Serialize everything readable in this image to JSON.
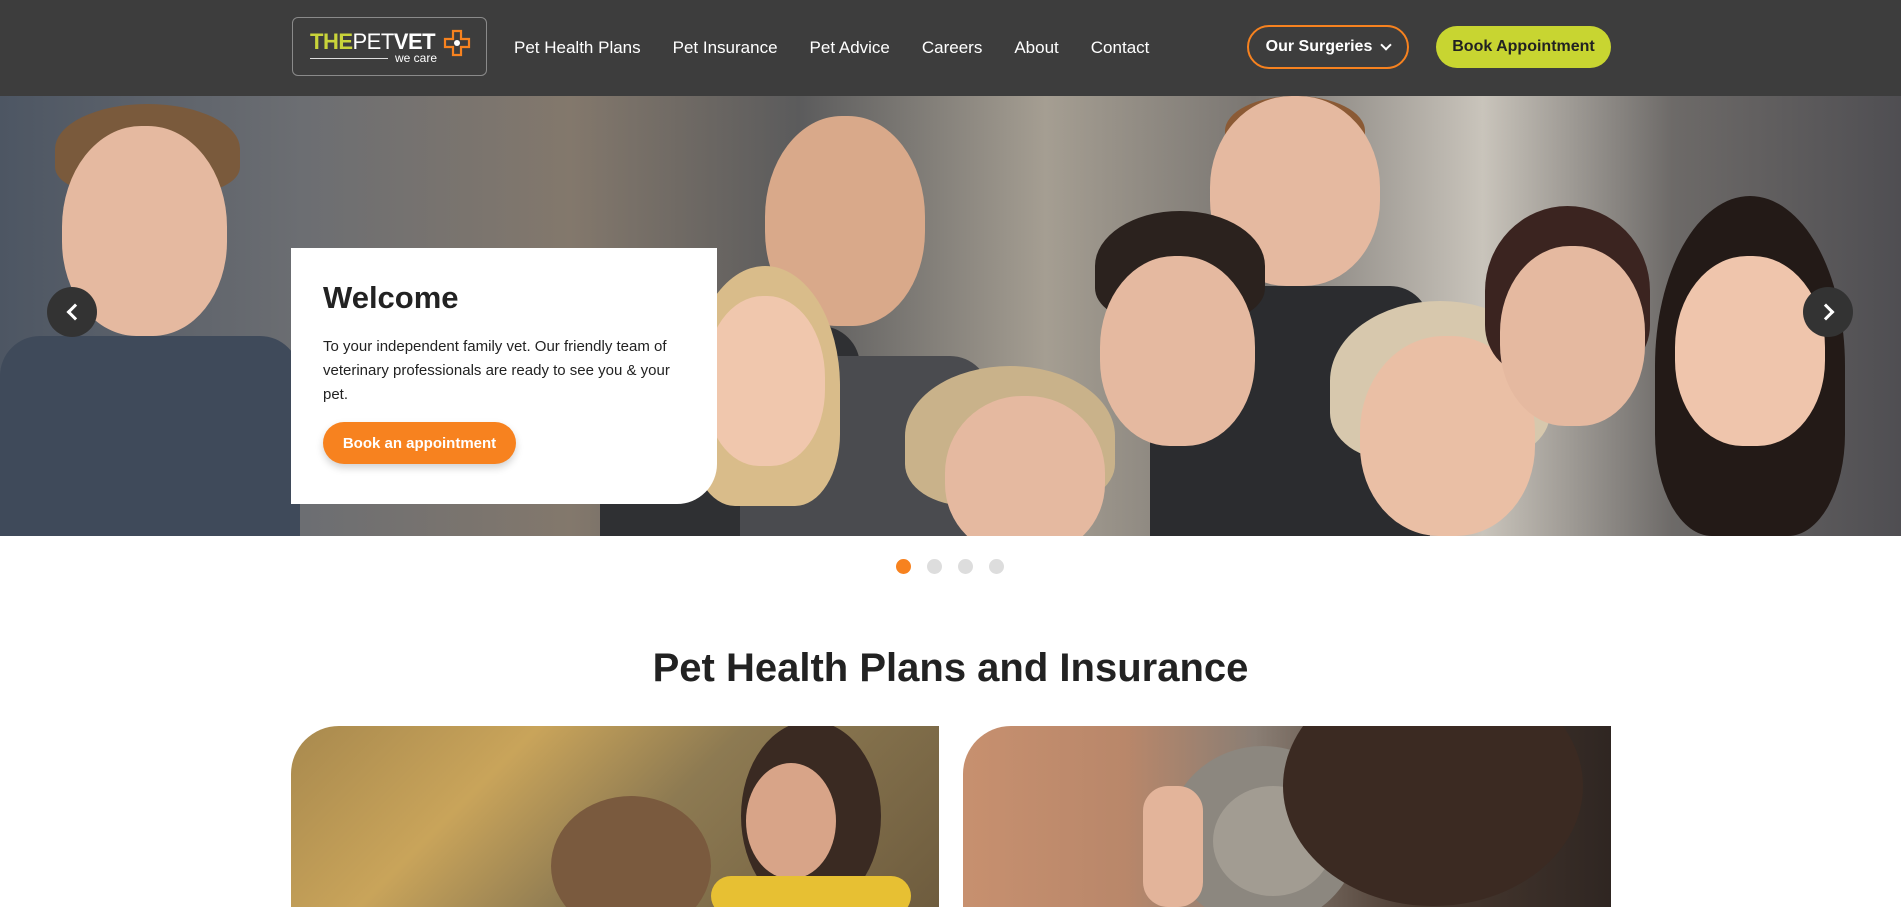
{
  "header": {
    "logo": {
      "the": "THE",
      "pet": "PET",
      "vet": "VET",
      "tagline": "we care"
    },
    "nav": [
      "Pet Health Plans",
      "Pet Insurance",
      "Pet Advice",
      "Careers",
      "About",
      "Contact"
    ],
    "surgeries_label": "Our Surgeries",
    "book_label": "Book Appointment"
  },
  "hero": {
    "title": "Welcome",
    "text": "To your independent family vet. Our friendly team of veterinary professionals are ready to see you & your pet.",
    "cta_label": "Book an appointment",
    "slide_count": 4,
    "active_slide": 1
  },
  "section": {
    "title": "Pet Health Plans and Insurance"
  },
  "colors": {
    "header_bg": "#3d3d3d",
    "accent_orange": "#f7821f",
    "accent_lime": "#c8d531"
  },
  "icons": [
    "chevron-down-icon",
    "chevron-left-icon",
    "chevron-right-icon",
    "vet-cross-icon"
  ]
}
